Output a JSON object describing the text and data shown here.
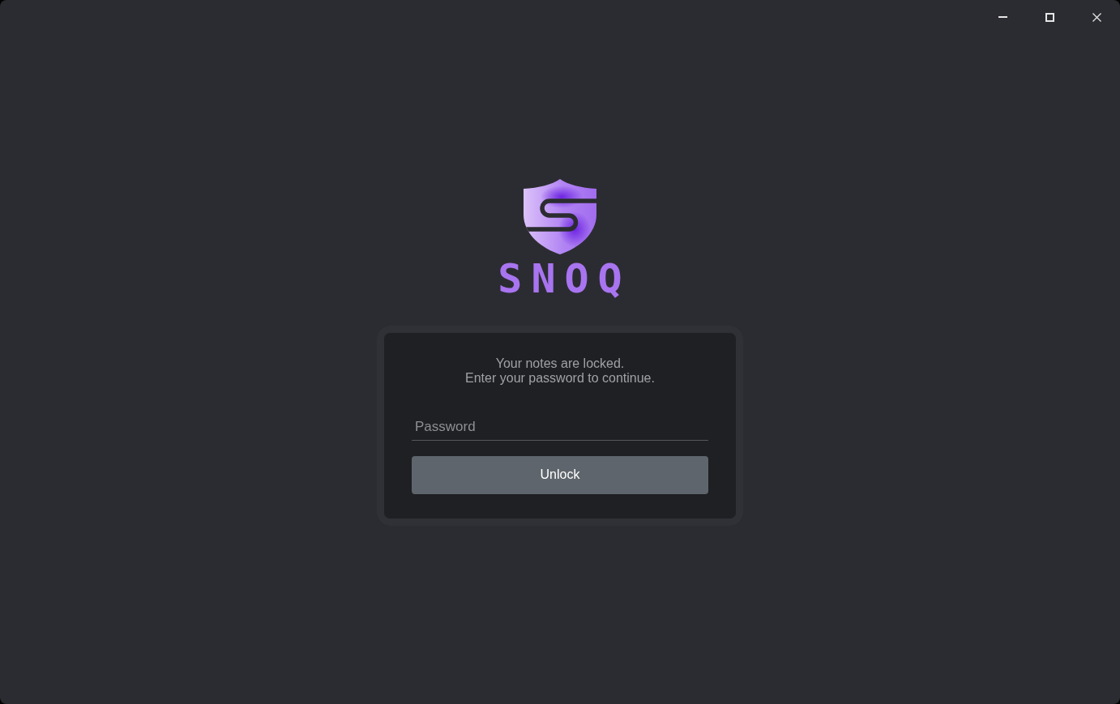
{
  "logo": {
    "wordmark": "SNOQ"
  },
  "unlock_card": {
    "message_lines": [
      "Your notes are locked.",
      "Enter your password to continue."
    ],
    "password_field": {
      "placeholder": "Password"
    },
    "unlock_button": {
      "label": "Unlock"
    }
  }
}
